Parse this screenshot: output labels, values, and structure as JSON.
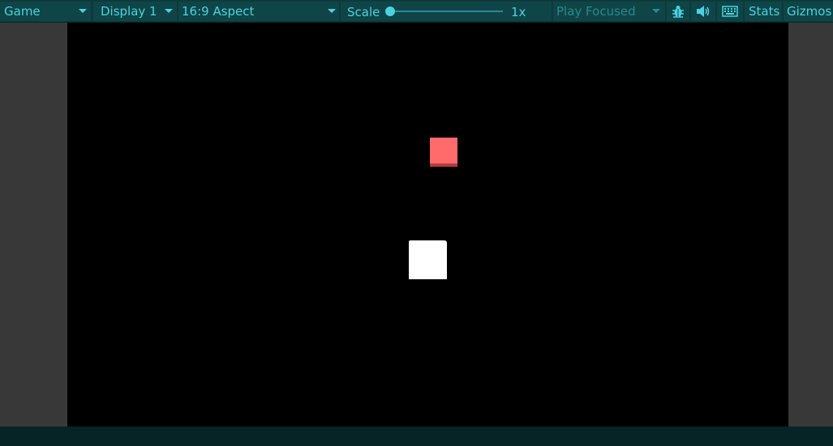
{
  "toolbar": {
    "view_dropdown": "Game",
    "display_dropdown": "Display 1",
    "aspect_dropdown": "16:9 Aspect",
    "scale_label": "Scale",
    "scale_value": "1x",
    "scale_level": 0.0,
    "play_mode_dropdown": "Play Focused",
    "stats_label": "Stats",
    "gizmos_label": "Gizmos",
    "icons": [
      "bug-icon",
      "speaker-icon",
      "keyboard-icon"
    ]
  },
  "scene": {
    "background": "#000000",
    "objects": [
      {
        "name": "red-cube",
        "color": "#ff6a6a"
      },
      {
        "name": "white-cube",
        "color": "#ffffff"
      }
    ]
  },
  "colors": {
    "toolbar_bg": "#0c3a3c",
    "accent": "#47d4e0",
    "dim": "#2a8890",
    "side_panel": "#383838"
  }
}
